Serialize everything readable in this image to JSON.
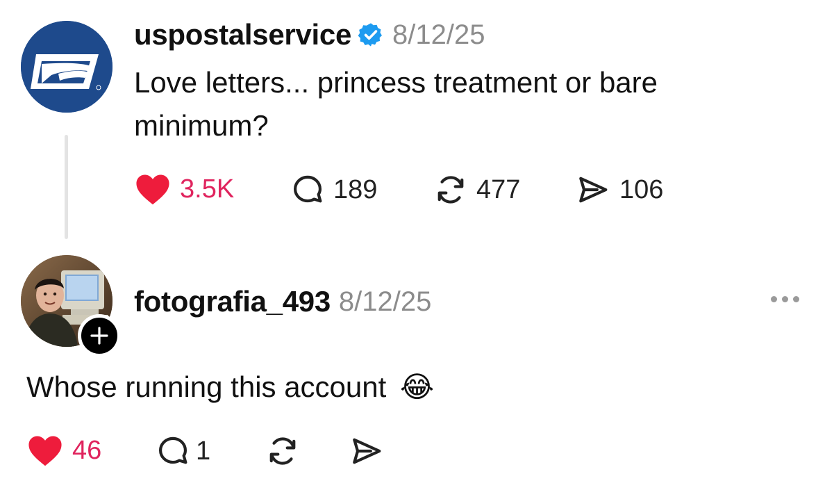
{
  "post": {
    "username": "uspostalservice",
    "timestamp": "8/12/25",
    "text": "Love letters... princess treatment or bare minimum?",
    "actions": {
      "likes": "3.5K",
      "comments": "189",
      "reposts": "477",
      "shares": "106"
    }
  },
  "reply": {
    "username": "fotografia_493",
    "timestamp": "8/12/25",
    "text": "Whose running this account",
    "emoji": "😂",
    "actions": {
      "likes": "46",
      "comments": "1"
    }
  },
  "colors": {
    "like_red": "#e0245e",
    "verified_blue": "#1d9bf0",
    "usps_blue": "#1e4a8c"
  },
  "icons": [
    "usps-logo-icon",
    "verified-badge-icon",
    "heart-icon",
    "comment-icon",
    "repost-icon",
    "share-icon",
    "more-options-icon",
    "follow-plus-icon"
  ]
}
